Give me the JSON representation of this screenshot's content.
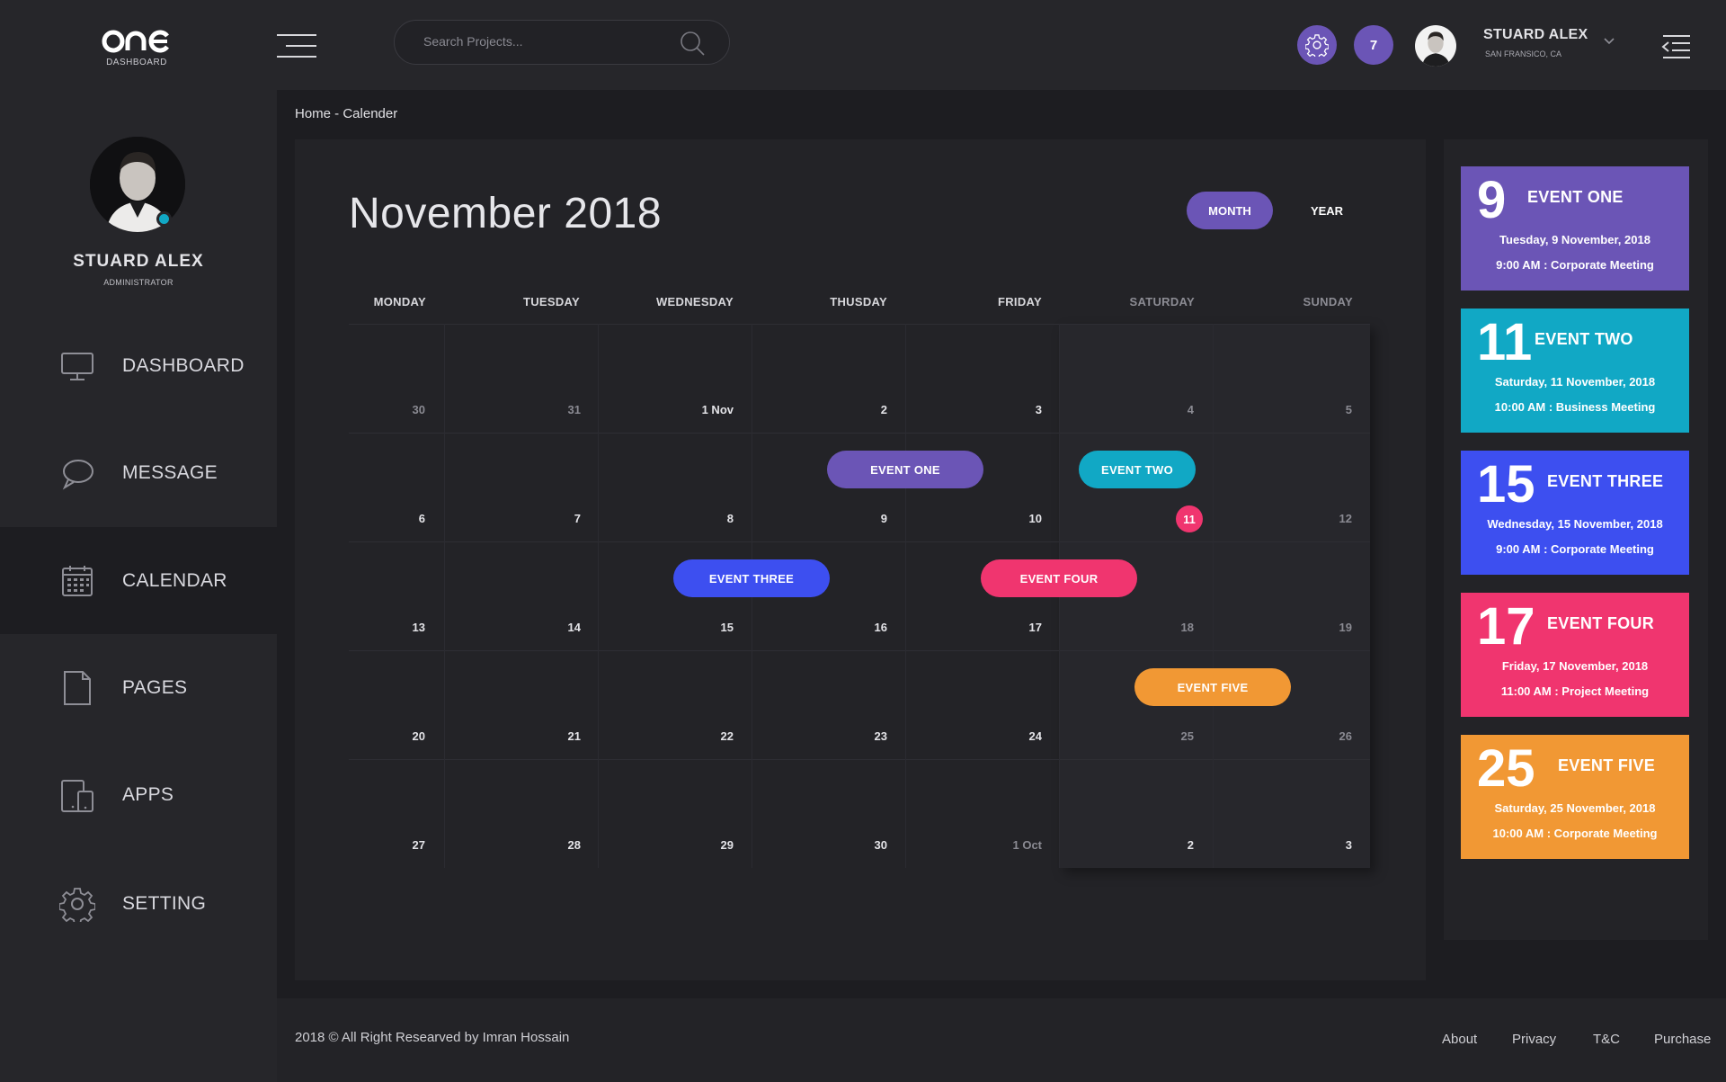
{
  "brand": {
    "logo_text": "one",
    "logo_sub": "DASHBOARD"
  },
  "colors": {
    "accent": "#6b55b6",
    "teal": "#11a8c5",
    "blue": "#3d4ff0",
    "pink": "#f0356f",
    "orange": "#f19834",
    "today": "#f0356f"
  },
  "profile": {
    "name": "STUARD ALEX",
    "role": "ADMINISTRATOR"
  },
  "sidebar": {
    "items": [
      {
        "label": "DASHBOARD",
        "icon": "monitor-icon"
      },
      {
        "label": "MESSAGE",
        "icon": "chat-bubble-icon"
      },
      {
        "label": "CALENDAR",
        "icon": "calendar-icon",
        "active": true
      },
      {
        "label": "PAGES",
        "icon": "page-icon"
      },
      {
        "label": "APPS",
        "icon": "devices-icon"
      },
      {
        "label": "SETTING",
        "icon": "gear-icon"
      }
    ]
  },
  "header": {
    "search_placeholder": "Search Projects...",
    "notification_count": "7",
    "user_name": "STUARD ALEX",
    "user_location": "SAN FRANSICO, CA"
  },
  "breadcrumb": "Home - Calender",
  "calendar": {
    "title": "November 2018",
    "view_month": "MONTH",
    "view_year": "YEAR",
    "weekdays": [
      "MONDAY",
      "TUESDAY",
      "WEDNESDAY",
      "THUSDAY",
      "FRIDAY",
      "SATURDAY",
      "SUNDAY"
    ],
    "weeks": [
      [
        "30",
        "31",
        "1 Nov",
        "2",
        "3",
        "4",
        "5"
      ],
      [
        "6",
        "7",
        "8",
        "9",
        "10",
        "11",
        "12"
      ],
      [
        "13",
        "14",
        "15",
        "16",
        "17",
        "18",
        "19"
      ],
      [
        "20",
        "21",
        "22",
        "23",
        "24",
        "25",
        "26"
      ],
      [
        "27",
        "28",
        "29",
        "30",
        "1 Oct",
        "2",
        "3"
      ]
    ],
    "today": "11",
    "pills": [
      {
        "label": "EVENT ONE",
        "color": "#6b55b6"
      },
      {
        "label": "EVENT TWO",
        "color": "#11a8c5"
      },
      {
        "label": "EVENT THREE",
        "color": "#3d4ff0"
      },
      {
        "label": "EVENT FOUR",
        "color": "#f0356f"
      },
      {
        "label": "EVENT FIVE",
        "color": "#f19834"
      }
    ]
  },
  "events": [
    {
      "day": "9",
      "name": "EVENT ONE",
      "date": "Tuesday, 9 November, 2018",
      "time": "9:00 AM  :  Corporate Meeting",
      "color": "#6b55b6"
    },
    {
      "day": "11",
      "name": "EVENT TWO",
      "date": "Saturday, 11 November, 2018",
      "time": "10:00 AM  :  Business Meeting",
      "color": "#11a8c5"
    },
    {
      "day": "15",
      "name": "EVENT THREE",
      "date": "Wednesday, 15 November, 2018",
      "time": "9:00 AM  :  Corporate Meeting",
      "color": "#3d4ff0"
    },
    {
      "day": "17",
      "name": "EVENT FOUR",
      "date": "Friday, 17 November, 2018",
      "time": "11:00 AM  :  Project Meeting",
      "color": "#f0356f"
    },
    {
      "day": "25",
      "name": "EVENT FIVE",
      "date": "Saturday, 25 November, 2018",
      "time": "10:00 AM  :  Corporate Meeting",
      "color": "#f19834"
    }
  ],
  "footer": {
    "copyright": "2018 © All Right Researved by Imran Hossain",
    "links": [
      "About",
      "Privacy",
      "T&C",
      "Purchase"
    ]
  }
}
